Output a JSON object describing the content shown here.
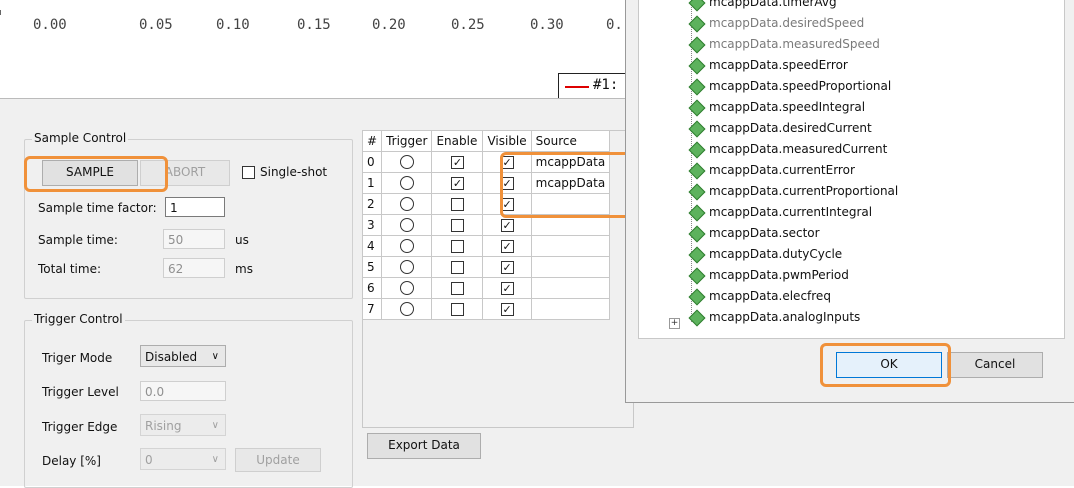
{
  "plot": {
    "x_ticks": [
      "0.00",
      "0.05",
      "0.10",
      "0.15",
      "0.20",
      "0.25",
      "0.30",
      "0."
    ],
    "legend_text": "#1:",
    "legend_color": "#dd0000"
  },
  "sample_control": {
    "title": "Sample Control",
    "sample_label": "SAMPLE",
    "abort_label": "ABORT",
    "single_shot_label": "Single-shot",
    "factor_label": "Sample time factor:",
    "factor_value": "1",
    "sample_time_label": "Sample time:",
    "sample_time_value": "50",
    "sample_time_unit": "us",
    "total_time_label": "Total time:",
    "total_time_value": "62",
    "total_time_unit": "ms"
  },
  "trigger_control": {
    "title": "Trigger Control",
    "mode_label": "Triger Mode",
    "mode_value": "Disabled",
    "level_label": "Trigger Level",
    "level_value": "0.0",
    "edge_label": "Trigger Edge",
    "edge_value": "Rising",
    "delay_label": "Delay [%]",
    "delay_value": "0",
    "update_label": "Update"
  },
  "channels": {
    "headers": [
      "#",
      "Trigger",
      "Enable",
      "Visible",
      "Source"
    ],
    "rows": [
      {
        "num": "0",
        "enable": true,
        "visible": true,
        "source": "mcappData"
      },
      {
        "num": "1",
        "enable": true,
        "visible": true,
        "source": "mcappData"
      },
      {
        "num": "2",
        "enable": false,
        "visible": true,
        "source": ""
      },
      {
        "num": "3",
        "enable": false,
        "visible": true,
        "source": ""
      },
      {
        "num": "4",
        "enable": false,
        "visible": true,
        "source": ""
      },
      {
        "num": "5",
        "enable": false,
        "visible": true,
        "source": ""
      },
      {
        "num": "6",
        "enable": false,
        "visible": true,
        "source": ""
      },
      {
        "num": "7",
        "enable": false,
        "visible": true,
        "source": ""
      }
    ],
    "export_label": "Export Data"
  },
  "dialog": {
    "tree_items": [
      {
        "label": "mcappData.timerAvg",
        "grey": false
      },
      {
        "label": "mcappData.desiredSpeed",
        "grey": true
      },
      {
        "label": "mcappData.measuredSpeed",
        "grey": true
      },
      {
        "label": "mcappData.speedError",
        "grey": false
      },
      {
        "label": "mcappData.speedProportional",
        "grey": false
      },
      {
        "label": "mcappData.speedIntegral",
        "grey": false
      },
      {
        "label": "mcappData.desiredCurrent",
        "grey": false
      },
      {
        "label": "mcappData.measuredCurrent",
        "grey": false
      },
      {
        "label": "mcappData.currentError",
        "grey": false
      },
      {
        "label": "mcappData.currentProportional",
        "grey": false
      },
      {
        "label": "mcappData.currentIntegral",
        "grey": false
      },
      {
        "label": "mcappData.sector",
        "grey": false
      },
      {
        "label": "mcappData.dutyCycle",
        "grey": false
      },
      {
        "label": "mcappData.pwmPeriod",
        "grey": false
      },
      {
        "label": "mcappData.elecfreq",
        "grey": false
      },
      {
        "label": "mcappData.analogInputs",
        "grey": false
      }
    ],
    "ok_label": "OK",
    "cancel_label": "Cancel"
  },
  "colors": {
    "highlight": "#f0913a",
    "tree_icon": "#5db25d"
  }
}
